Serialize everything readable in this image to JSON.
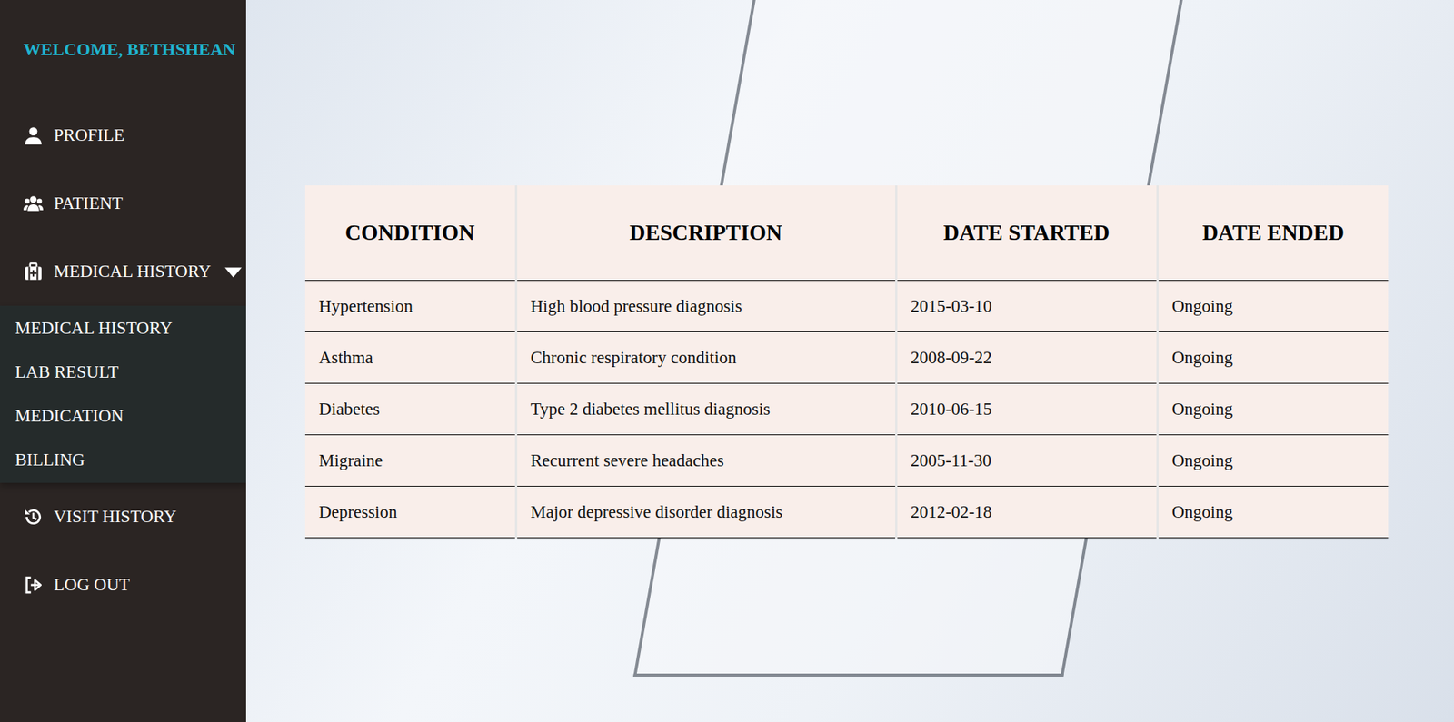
{
  "sidebar": {
    "welcome": "WELCOME, BETHSHEAN",
    "items": [
      {
        "label": "PROFILE",
        "icon": "user"
      },
      {
        "label": "PATIENT",
        "icon": "users"
      },
      {
        "label": "MEDICAL HISTORY",
        "icon": "medkit",
        "expanded": true,
        "submenu": [
          {
            "label": "MEDICAL HISTORY"
          },
          {
            "label": "LAB RESULT"
          },
          {
            "label": "MEDICATION"
          },
          {
            "label": "BILLING"
          }
        ]
      },
      {
        "label": "VISIT HISTORY",
        "icon": "history"
      },
      {
        "label": "LOG OUT",
        "icon": "logout"
      }
    ]
  },
  "table": {
    "columns": [
      "CONDITION",
      "DESCRIPTION",
      "DATE STARTED",
      "DATE ENDED"
    ],
    "rows": [
      [
        "Hypertension",
        "High blood pressure diagnosis",
        "2015-03-10",
        "Ongoing"
      ],
      [
        "Asthma",
        "Chronic respiratory condition",
        "2008-09-22",
        "Ongoing"
      ],
      [
        "Diabetes",
        "Type 2 diabetes mellitus diagnosis",
        "2010-06-15",
        "Ongoing"
      ],
      [
        "Migraine",
        "Recurrent severe headaches",
        "2005-11-30",
        "Ongoing"
      ],
      [
        "Depression",
        "Major depressive disorder diagnosis",
        "2012-02-18",
        "Ongoing"
      ]
    ]
  }
}
